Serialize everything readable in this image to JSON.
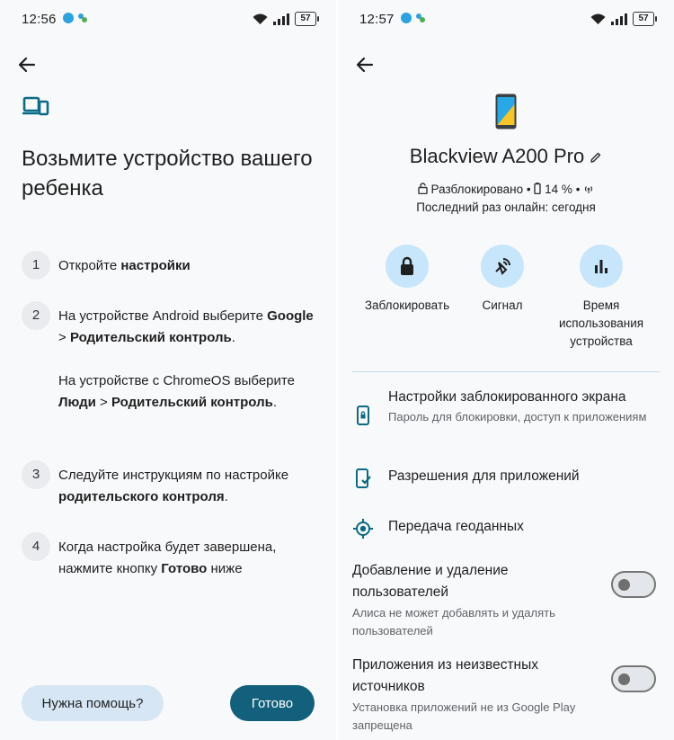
{
  "left_screen": {
    "status": {
      "time": "12:56",
      "battery": "57"
    },
    "title": "Возьмите устройство вашего ребенка",
    "steps": [
      {
        "num": "1",
        "text_a": "Откройте ",
        "bold_a": "настройки"
      },
      {
        "num": "2",
        "text_a": "На устройстве Android выберите ",
        "bold_a": "Google",
        "sep_a": " > ",
        "bold_b": "Родительский контроль",
        "end_a": ".",
        "text_b": "На устройстве с ChromeOS выберите ",
        "bold_c": "Люди",
        "sep_b": " > ",
        "bold_d": "Родительский контроль",
        "end_b": "."
      },
      {
        "num": "3",
        "text_a": "Следуйте инструкциям по настройке ",
        "bold_a": "родительского контроля",
        "end_a": "."
      },
      {
        "num": "4",
        "text_a": "Когда настройка будет завершена, нажмите кнопку ",
        "bold_a": "Готово",
        "end_a": " ниже"
      }
    ],
    "help_label": "Нужна помощь?",
    "done_label": "Готово"
  },
  "right_screen": {
    "status": {
      "time": "12:57",
      "battery": "57"
    },
    "device_name": "Blackview A200 Pro",
    "lock_status": "Разблокировано",
    "separator": "•",
    "battery_level": "14 %",
    "last_online": "Последний раз онлайн: сегодня",
    "actions": [
      {
        "label": "Заблокировать",
        "icon": "lock-icon"
      },
      {
        "label": "Сигнал",
        "icon": "ring-icon"
      },
      {
        "label": "Время использования устройства",
        "icon": "bar-chart-icon"
      }
    ],
    "settings": [
      {
        "title": "Настройки заблокированного экрана",
        "subtitle": "Пароль для блокировки, доступ к приложениям",
        "icon": "lock-screen-icon"
      },
      {
        "title": "Разрешения для приложений",
        "subtitle": "",
        "icon": "app-permissions-icon"
      },
      {
        "title": "Передача геоданных",
        "subtitle": "",
        "icon": "location-icon"
      }
    ],
    "toggles": [
      {
        "title": "Добавление и удаление пользователей",
        "subtitle": "Алиса не может добавлять и удалять пользователей",
        "on": false
      },
      {
        "title": "Приложения из неизвестных источников",
        "subtitle": "Установка приложений не из Google Play запрещена",
        "on": false
      }
    ]
  },
  "colors": {
    "accent": "#13607c",
    "action_circle": "#c7e6fb",
    "help_button": "#d6e6f5",
    "icon_teal": "#0b6b84"
  }
}
